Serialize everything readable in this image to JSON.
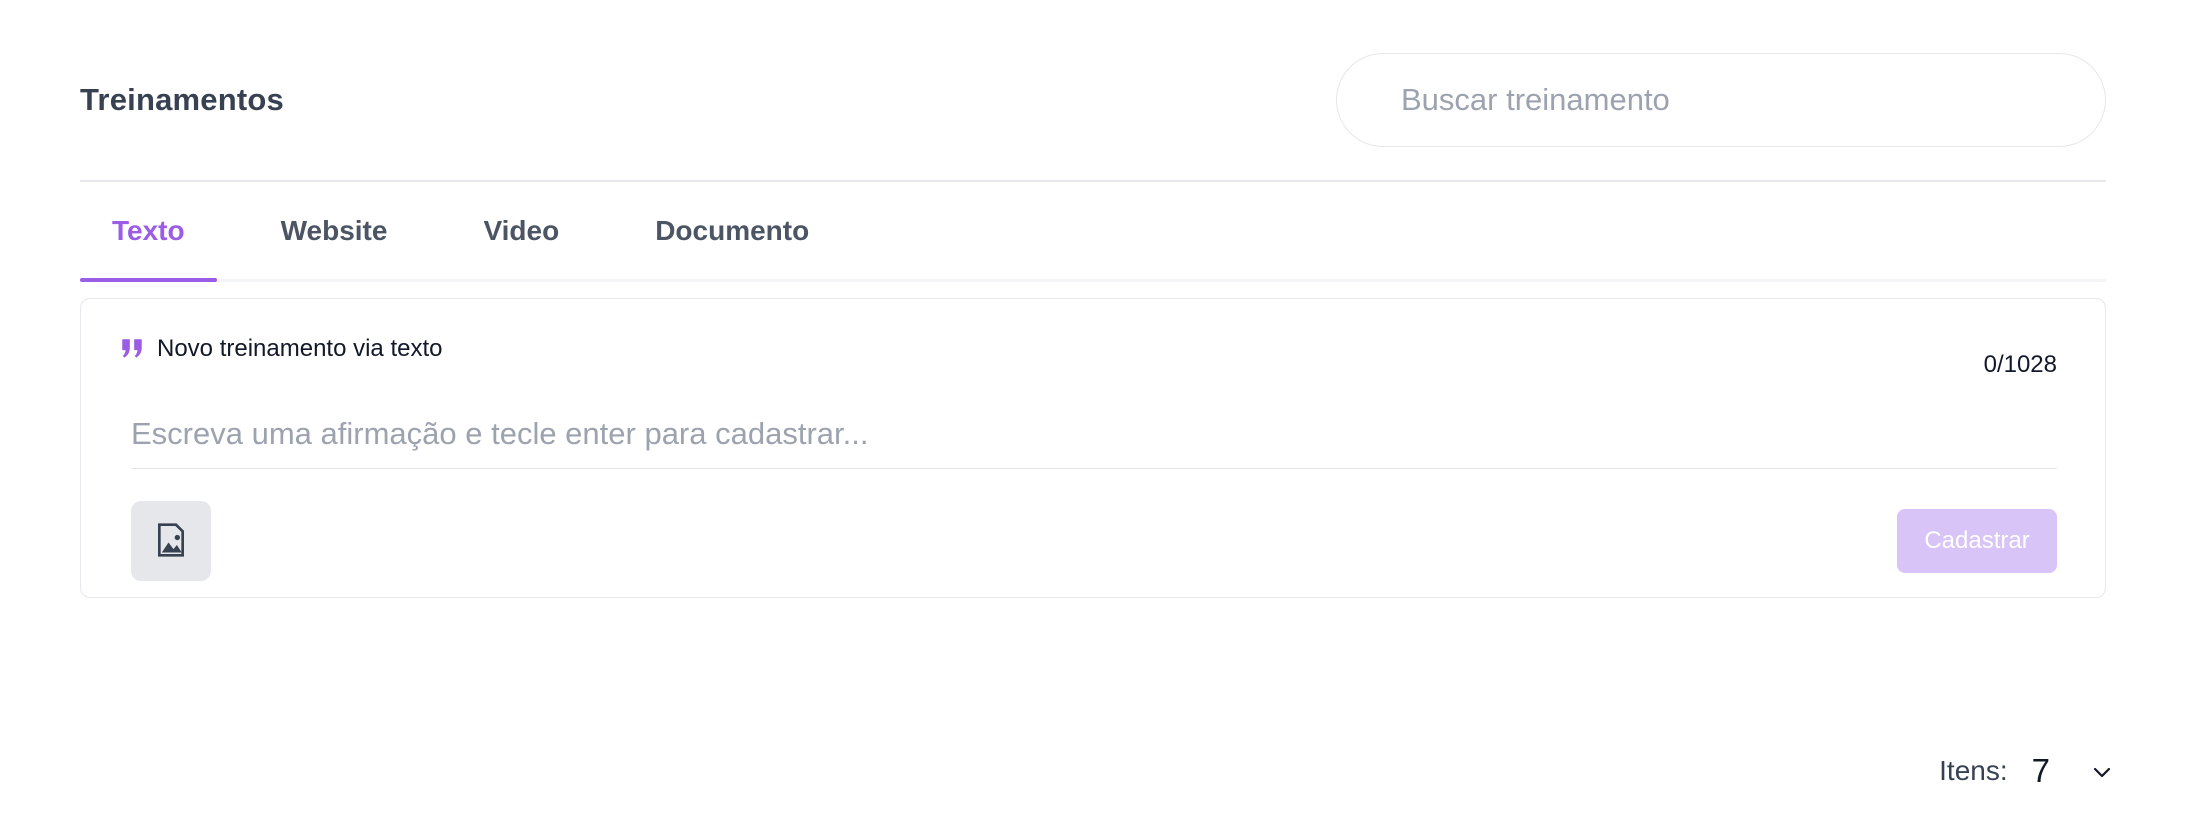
{
  "header": {
    "title": "Treinamentos",
    "search_placeholder": "Buscar treinamento"
  },
  "tabs": [
    {
      "label": "Texto",
      "active": true
    },
    {
      "label": "Website",
      "active": false
    },
    {
      "label": "Video",
      "active": false
    },
    {
      "label": "Documento",
      "active": false
    }
  ],
  "form": {
    "label": "Novo treinamento via texto",
    "label_icon": "quote-icon",
    "counter": "0/1028",
    "input_placeholder": "Escreva uma afirmação e tecle enter para cadastrar...",
    "input_value": "",
    "image_button_icon": "image-icon",
    "submit_label": "Cadastrar"
  },
  "pagination": {
    "items_label": "Itens:",
    "items_value": "7"
  },
  "colors": {
    "accent": "#9b5de5",
    "submit_disabled": "#d8c4f7",
    "border": "#e5e7eb"
  }
}
